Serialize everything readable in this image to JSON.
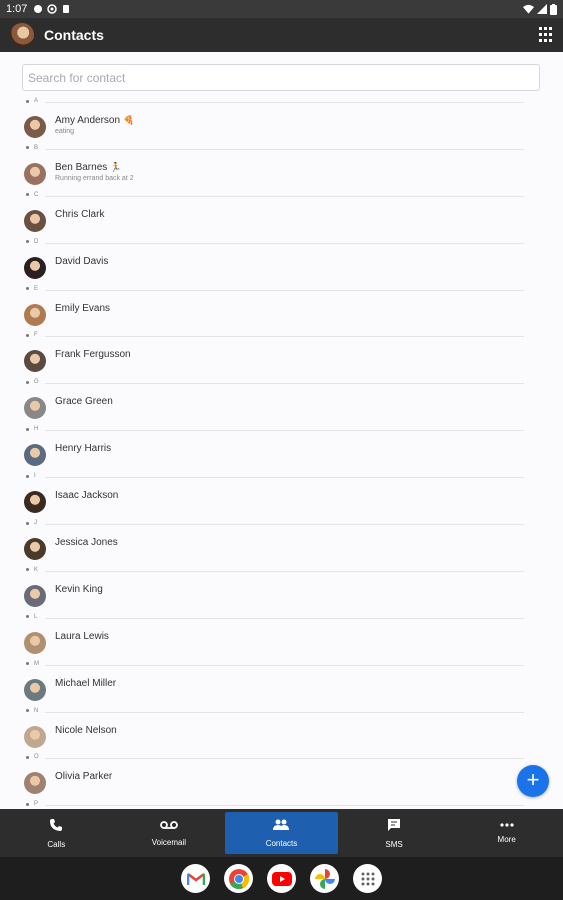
{
  "status_bar": {
    "time": "1:07",
    "icons": [
      "dot-icon",
      "settings-icon",
      "sim-icon"
    ],
    "right_icons": [
      "wifi-icon",
      "signal-icon",
      "battery-icon"
    ]
  },
  "app_bar": {
    "title": "Contacts",
    "avatar_icon": "user-avatar",
    "action_icon": "dialpad-icon"
  },
  "search": {
    "placeholder": "Search for contact",
    "value": ""
  },
  "contacts": [
    {
      "letter": "A",
      "name": "Amy Anderson",
      "status": "eating",
      "emoji": "🍕",
      "avatar_color": "#7a5a48"
    },
    {
      "letter": "B",
      "name": "Ben Barnes",
      "status": "Running errand back at 2",
      "emoji": "🏃",
      "avatar_color": "#9a7060"
    },
    {
      "letter": "C",
      "name": "Chris Clark",
      "status": "",
      "emoji": "",
      "avatar_color": "#6a5040"
    },
    {
      "letter": "D",
      "name": "David Davis",
      "status": "",
      "emoji": "",
      "avatar_color": "#2a2020"
    },
    {
      "letter": "E",
      "name": "Emily Evans",
      "status": "",
      "emoji": "",
      "avatar_color": "#b07a50"
    },
    {
      "letter": "F",
      "name": "Frank Fergusson",
      "status": "",
      "emoji": "",
      "avatar_color": "#5a4a40"
    },
    {
      "letter": "G",
      "name": "Grace Green",
      "status": "",
      "emoji": "",
      "avatar_color": "#888888"
    },
    {
      "letter": "H",
      "name": "Henry Harris",
      "status": "",
      "emoji": "",
      "avatar_color": "#5a6a80"
    },
    {
      "letter": "I",
      "name": "Isaac Jackson",
      "status": "",
      "emoji": "",
      "avatar_color": "#3a2a20"
    },
    {
      "letter": "J",
      "name": "Jessica Jones",
      "status": "",
      "emoji": "",
      "avatar_color": "#4a3a2a"
    },
    {
      "letter": "K",
      "name": "Kevin King",
      "status": "",
      "emoji": "",
      "avatar_color": "#6a6a78"
    },
    {
      "letter": "L",
      "name": "Laura Lewis",
      "status": "",
      "emoji": "",
      "avatar_color": "#b09070"
    },
    {
      "letter": "M",
      "name": "Michael Miller",
      "status": "",
      "emoji": "",
      "avatar_color": "#6a7a80"
    },
    {
      "letter": "N",
      "name": "Nicole Nelson",
      "status": "",
      "emoji": "",
      "avatar_color": "#c0a890"
    },
    {
      "letter": "O",
      "name": "Olivia Parker",
      "status": "",
      "emoji": "",
      "avatar_color": "#a08070"
    },
    {
      "letter": "P",
      "name": "",
      "status": "",
      "emoji": "",
      "avatar_color": "#999999"
    }
  ],
  "fab": {
    "label": "+",
    "icon": "plus-icon"
  },
  "bottom_nav": [
    {
      "label": "Calls",
      "icon": "phone-icon",
      "active": false
    },
    {
      "label": "Voicemail",
      "icon": "voicemail-icon",
      "active": false
    },
    {
      "label": "Contacts",
      "icon": "people-icon",
      "active": true
    },
    {
      "label": "SMS",
      "icon": "message-icon",
      "active": false
    },
    {
      "label": "More",
      "icon": "more-icon",
      "active": false
    }
  ],
  "dock": [
    "gmail-icon",
    "chrome-icon",
    "youtube-icon",
    "photos-icon",
    "apps-icon"
  ],
  "colors": {
    "accent": "#1a73e8",
    "active_nav": "#1f5fb0",
    "bar": "#2d2d2d"
  }
}
